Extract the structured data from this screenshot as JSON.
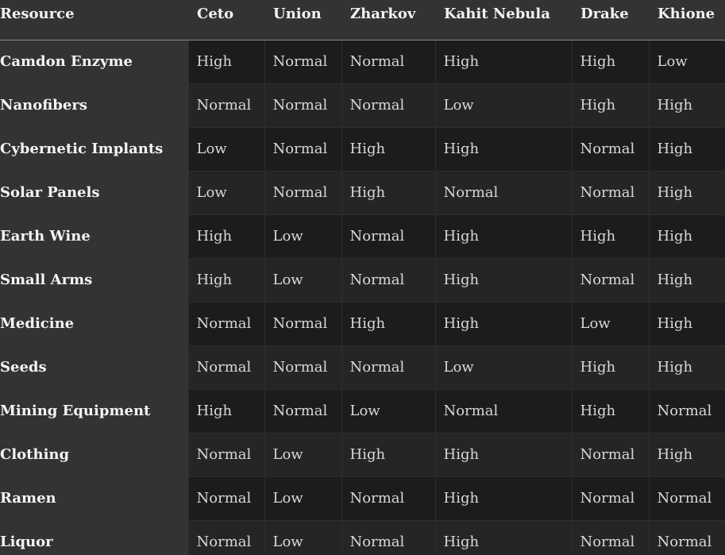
{
  "columns": [
    "Resource",
    "Ceto",
    "Union",
    "Zharkov",
    "Kahit Nebula",
    "Drake",
    "Khione"
  ],
  "rows": [
    {
      "resource": "Camdon Enzyme",
      "values": [
        "High",
        "Normal",
        "Normal",
        "High",
        "High",
        "Low"
      ]
    },
    {
      "resource": "Nanofibers",
      "values": [
        "Normal",
        "Normal",
        "Normal",
        "Low",
        "High",
        "High"
      ]
    },
    {
      "resource": "Cybernetic Implants",
      "values": [
        "Low",
        "Normal",
        "High",
        "High",
        "Normal",
        "High"
      ]
    },
    {
      "resource": "Solar Panels",
      "values": [
        "Low",
        "Normal",
        "High",
        "Normal",
        "Normal",
        "High"
      ]
    },
    {
      "resource": "Earth Wine",
      "values": [
        "High",
        "Low",
        "Normal",
        "High",
        "High",
        "High"
      ]
    },
    {
      "resource": "Small Arms",
      "values": [
        "High",
        "Low",
        "Normal",
        "High",
        "Normal",
        "High"
      ]
    },
    {
      "resource": "Medicine",
      "values": [
        "Normal",
        "Normal",
        "High",
        "High",
        "Low",
        "High"
      ]
    },
    {
      "resource": "Seeds",
      "values": [
        "Normal",
        "Normal",
        "Normal",
        "Low",
        "High",
        "High"
      ]
    },
    {
      "resource": "Mining Equipment",
      "values": [
        "High",
        "Normal",
        "Low",
        "Normal",
        "High",
        "Normal"
      ]
    },
    {
      "resource": "Clothing",
      "values": [
        "Normal",
        "Low",
        "High",
        "High",
        "Normal",
        "High"
      ]
    },
    {
      "resource": "Ramen",
      "values": [
        "Normal",
        "Low",
        "Normal",
        "High",
        "Normal",
        "Normal"
      ]
    },
    {
      "resource": "Liquor",
      "values": [
        "Normal",
        "Low",
        "Normal",
        "High",
        "Normal",
        "Normal"
      ]
    }
  ]
}
